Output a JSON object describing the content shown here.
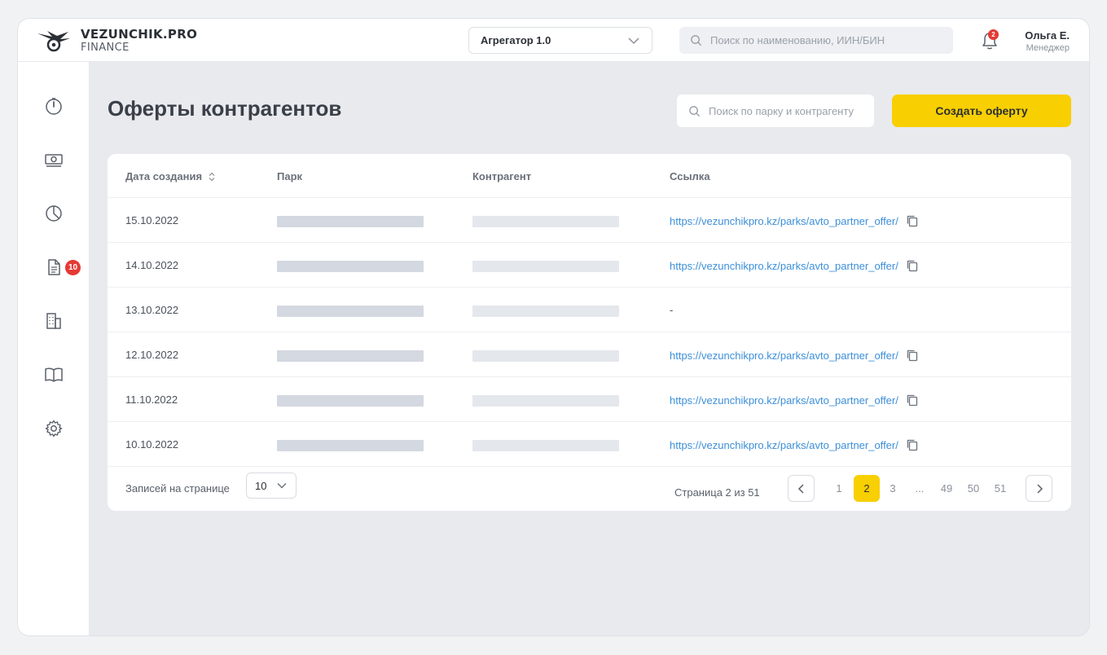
{
  "brand": {
    "line1": "VEZUNCHIK.PRO",
    "line2": "FINANCE"
  },
  "header": {
    "aggregator_selected": "Агрегатор 1.0",
    "search_placeholder": "Поиск по наименованию, ИИН/БИН",
    "notifications_count": "2",
    "user_name": "Ольга Е.",
    "user_role": "Менеджер"
  },
  "sidebar": {
    "items": [
      {
        "icon": "speedometer-icon"
      },
      {
        "icon": "money-icon"
      },
      {
        "icon": "pie-chart-icon"
      },
      {
        "icon": "document-icon",
        "badge": "10"
      },
      {
        "icon": "building-icon"
      },
      {
        "icon": "book-icon"
      },
      {
        "icon": "gear-icon"
      }
    ]
  },
  "page": {
    "title": "Оферты контрагентов",
    "search_placeholder": "Поиск по парку и контрагенту",
    "create_button": "Создать оферту"
  },
  "table": {
    "columns": [
      "Дата создания",
      "Парк",
      "Контрагент",
      "Ссылка"
    ],
    "rows": [
      {
        "date": "15.10.2022",
        "link": "https://vezunchikpro.kz/parks/avto_partner_offer/"
      },
      {
        "date": "14.10.2022",
        "link": "https://vezunchikpro.kz/parks/avto_partner_offer/"
      },
      {
        "date": "13.10.2022",
        "link": "-"
      },
      {
        "date": "12.10.2022",
        "link": "https://vezunchikpro.kz/parks/avto_partner_offer/"
      },
      {
        "date": "11.10.2022",
        "link": "https://vezunchikpro.kz/parks/avto_partner_offer/"
      },
      {
        "date": "10.10.2022",
        "link": "https://vezunchikpro.kz/parks/avto_partner_offer/"
      }
    ]
  },
  "pagination": {
    "per_page_label": "Записей на странице",
    "per_page_value": "10",
    "page_info": "Страница 2 из 51",
    "pages": [
      "1",
      "2",
      "3",
      "...",
      "49",
      "50",
      "51"
    ],
    "current_page": "2"
  },
  "colors": {
    "accent": "#f8cf00",
    "link": "#3d8fd8",
    "badge": "#e53935"
  }
}
